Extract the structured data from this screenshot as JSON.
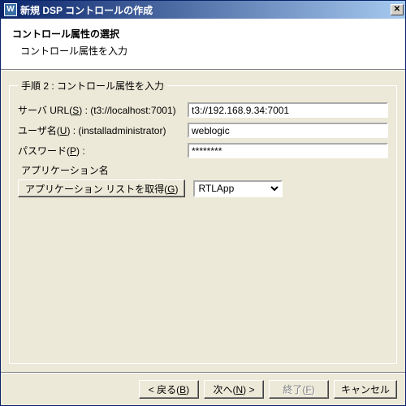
{
  "window": {
    "title": "新規 DSP コントロールの作成",
    "icon_letter": "W"
  },
  "header": {
    "title": "コントロール属性の選択",
    "subtitle": "コントロール属性を入力"
  },
  "group": {
    "legend": "手順 2 : コントロール属性を入力",
    "server_url": {
      "label_pre": "サーバ URL(",
      "label_key": "S",
      "label_post": ") : (t3://localhost:7001)",
      "value": "t3://192.168.9.34:7001"
    },
    "username": {
      "label_pre": "ユーザ名(",
      "label_key": "U",
      "label_post": ") : (installadministrator)",
      "value": "weblogic"
    },
    "password": {
      "label_pre": "パスワード(",
      "label_key": "P",
      "label_post": ") :",
      "value": "********"
    },
    "appname": {
      "label": "アプリケーション名",
      "get_list_pre": "アプリケーション リストを取得(",
      "get_list_key": "G",
      "get_list_post": ")",
      "selected": "RTLApp"
    }
  },
  "footer": {
    "back_pre": "< 戻る(",
    "back_key": "B",
    "back_post": ")",
    "next_pre": "次へ(",
    "next_key": "N",
    "next_post": ") >",
    "finish_pre": "終了(",
    "finish_key": "F",
    "finish_post": ")",
    "cancel": "キャンセル"
  }
}
